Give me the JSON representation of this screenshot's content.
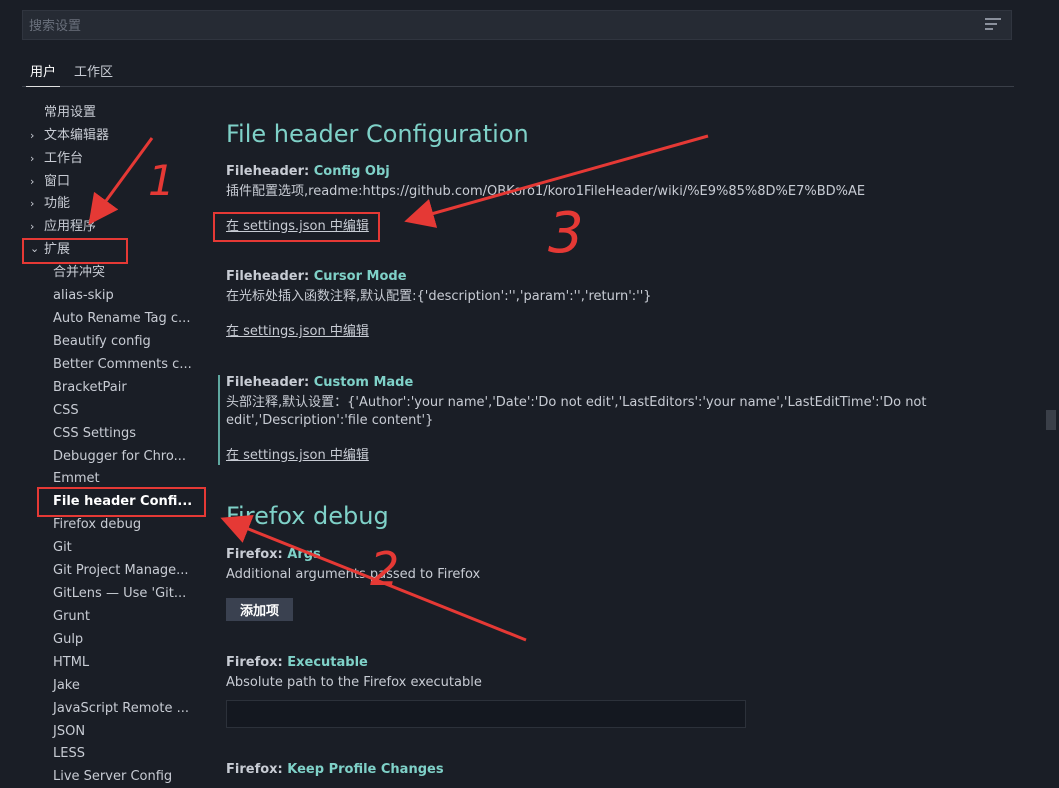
{
  "search": {
    "placeholder": "搜索设置",
    "value": ""
  },
  "tabs": [
    {
      "label": "用户"
    },
    {
      "label": "工作区"
    }
  ],
  "toc": {
    "items": [
      {
        "label": "常用设置"
      },
      {
        "label": "文本编辑器"
      },
      {
        "label": "工作台"
      },
      {
        "label": "窗口"
      },
      {
        "label": "功能"
      },
      {
        "label": "应用程序"
      },
      {
        "label": "扩展"
      },
      {
        "label": "合并冲突"
      },
      {
        "label": "alias-skip"
      },
      {
        "label": "Auto Rename Tag c..."
      },
      {
        "label": "Beautify config"
      },
      {
        "label": "Better Comments c..."
      },
      {
        "label": "BracketPair"
      },
      {
        "label": "CSS"
      },
      {
        "label": "CSS Settings"
      },
      {
        "label": "Debugger for Chro..."
      },
      {
        "label": "Emmet"
      },
      {
        "label": "File header Confi..."
      },
      {
        "label": "Firefox debug"
      },
      {
        "label": "Git"
      },
      {
        "label": "Git Project Manage..."
      },
      {
        "label": "GitLens — Use 'Git..."
      },
      {
        "label": "Grunt"
      },
      {
        "label": "Gulp"
      },
      {
        "label": "HTML"
      },
      {
        "label": "Jake"
      },
      {
        "label": "JavaScript Remote ..."
      },
      {
        "label": "JSON"
      },
      {
        "label": "LESS"
      },
      {
        "label": "Live Server Config"
      }
    ],
    "chevron_collapsed": "›",
    "chevron_expanded": "⌄"
  },
  "sections": {
    "file_header": {
      "title": "File header Configuration",
      "settings": [
        {
          "category": "Fileheader: ",
          "name": "Config Obj",
          "description": "插件配置选项,readme:https://github.com/OBKoro1/koro1FileHeader/wiki/%E9%85%8D%E7%BD%AE",
          "link": "在 settings.json 中编辑"
        },
        {
          "category": "Fileheader: ",
          "name": "Cursor Mode",
          "description": "在光标处插入函数注释,默认配置:{'description':'','param':'','return':''}",
          "link": "在 settings.json 中编辑"
        },
        {
          "category": "Fileheader: ",
          "name": "Custom Made",
          "description": "头部注释,默认设置：{'Author':'your name','Date':'Do not edit','LastEditors':'your name','LastEditTime':'Do not edit','Description':'file content'}",
          "link": "在 settings.json 中编辑"
        }
      ]
    },
    "firefox": {
      "title": "Firefox debug",
      "settings": [
        {
          "category": "Firefox: ",
          "name": "Args",
          "description": "Additional arguments passed to Firefox",
          "button": "添加项"
        },
        {
          "category": "Firefox: ",
          "name": "Executable",
          "description": "Absolute path to the Firefox executable",
          "input_value": ""
        },
        {
          "category": "Firefox: ",
          "name": "Keep Profile Changes"
        }
      ]
    }
  },
  "annotations": {
    "label_1": "1",
    "label_2": "2",
    "label_3": "3",
    "color": "#e53935"
  },
  "colors": {
    "background": "#1a1e26",
    "accent": "#7fd1c8",
    "text": "#c8ccd4",
    "annotation": "#e53935"
  }
}
